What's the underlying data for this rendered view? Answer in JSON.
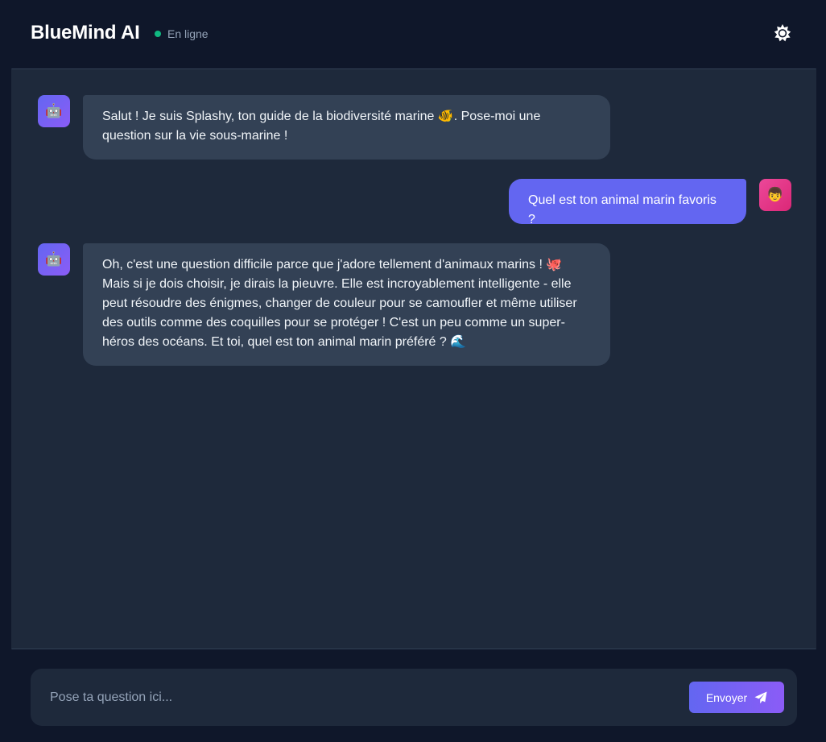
{
  "header": {
    "title": "BlueMind AI",
    "status_label": "En ligne",
    "theme_icon": "sun-icon"
  },
  "colors": {
    "background": "#0f172a",
    "chat_background": "#1e293b",
    "bot_bubble": "#334155",
    "user_bubble": "#6366f1",
    "status_online": "#10b981",
    "accent": "#6366f1"
  },
  "messages": [
    {
      "sender": "bot",
      "avatar": "🤖",
      "text": "Salut ! Je suis Splashy, ton guide de la biodiversité marine 🐠. Pose-moi une question sur la vie sous-marine !"
    },
    {
      "sender": "user",
      "avatar": "👦",
      "text": "Quel est ton animal marin favoris ?"
    },
    {
      "sender": "bot",
      "avatar": "🤖",
      "text": "Oh, c'est une question difficile parce que j'adore tellement d'animaux marins ! 🐙 Mais si je dois choisir, je dirais la pieuvre. Elle est incroyablement intelligente - elle peut résoudre des énigmes, changer de couleur pour se camoufler et même utiliser des outils comme des coquilles pour se protéger ! C'est un peu comme un super-héros des océans. Et toi, quel est ton animal marin préféré ? 🌊"
    }
  ],
  "composer": {
    "placeholder": "Pose ta question ici...",
    "value": "",
    "send_label": "Envoyer",
    "send_icon": "paper-plane-icon"
  }
}
